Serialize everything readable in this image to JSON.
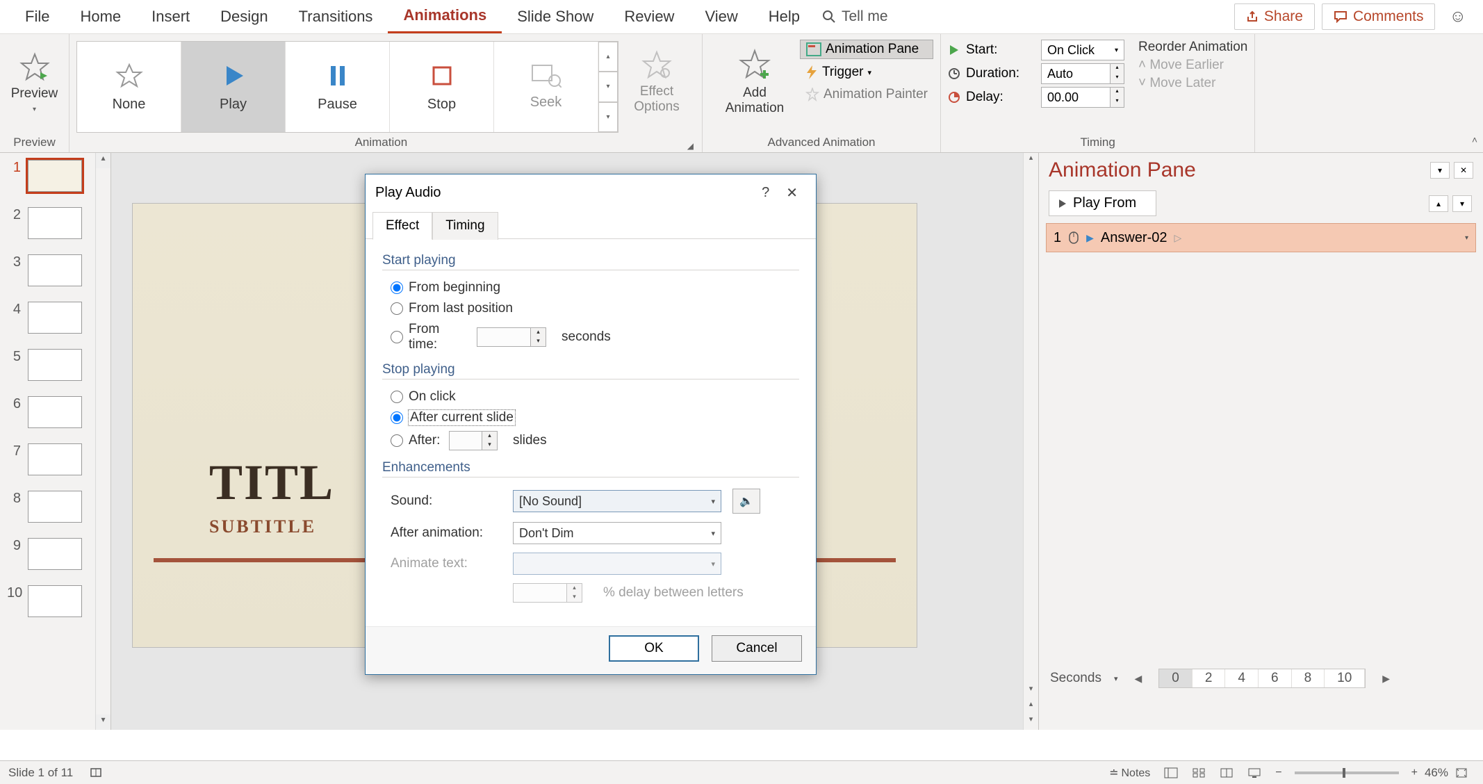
{
  "ribbonTabs": {
    "file": "File",
    "home": "Home",
    "insert": "Insert",
    "design": "Design",
    "transitions": "Transitions",
    "animations": "Animations",
    "slideshow": "Slide Show",
    "review": "Review",
    "view": "View",
    "help": "Help",
    "tellme": "Tell me"
  },
  "topRight": {
    "share": "Share",
    "comments": "Comments"
  },
  "ribbon": {
    "preview": {
      "label": "Preview",
      "group": "Preview"
    },
    "gallery": {
      "none": "None",
      "play": "Play",
      "pause": "Pause",
      "stop": "Stop",
      "seek": "Seek"
    },
    "effectOptions": "Effect\nOptions",
    "animationGroup": "Animation",
    "addAnimation": "Add\nAnimation",
    "animationPane": "Animation Pane",
    "trigger": "Trigger",
    "animationPainter": "Animation Painter",
    "advancedGroup": "Advanced Animation",
    "timing": {
      "start": "Start:",
      "startValue": "On Click",
      "duration": "Duration:",
      "durationValue": "Auto",
      "delay": "Delay:",
      "delayValue": "00.00",
      "group": "Timing"
    },
    "reorder": {
      "header": "Reorder Animation",
      "earlier": "Move Earlier",
      "later": "Move Later"
    }
  },
  "slide": {
    "title": "TITL",
    "subtitle": "SUBTITLE"
  },
  "thumbs": {
    "count": 11,
    "current": 1,
    "numbers": [
      "1",
      "2",
      "3",
      "4",
      "5",
      "6",
      "7",
      "8",
      "9",
      "10"
    ]
  },
  "animPane": {
    "title": "Animation Pane",
    "playFrom": "Play From",
    "item": {
      "index": "1",
      "name": "Answer-02"
    },
    "seconds": "Seconds",
    "marks": [
      "0",
      "2",
      "4",
      "6",
      "8",
      "10"
    ]
  },
  "dialog": {
    "title": "Play Audio",
    "tabs": {
      "effect": "Effect",
      "timing": "Timing"
    },
    "startPlaying": {
      "header": "Start playing",
      "fromBeginning": "From beginning",
      "fromLast": "From last position",
      "fromTime": "From time:",
      "seconds": "seconds"
    },
    "stopPlaying": {
      "header": "Stop playing",
      "onClick": "On click",
      "afterCurrent": "After current slide",
      "after": "After:",
      "slides": "slides"
    },
    "enhancements": {
      "header": "Enhancements",
      "sound": "Sound:",
      "soundValue": "[No Sound]",
      "afterAnim": "After animation:",
      "afterAnimValue": "Don't Dim",
      "animateText": "Animate text:",
      "delayBetween": "% delay between letters"
    },
    "buttons": {
      "ok": "OK",
      "cancel": "Cancel"
    }
  },
  "status": {
    "slideOf": "Slide 1 of 11",
    "notes": "Notes",
    "zoom": "46%"
  }
}
